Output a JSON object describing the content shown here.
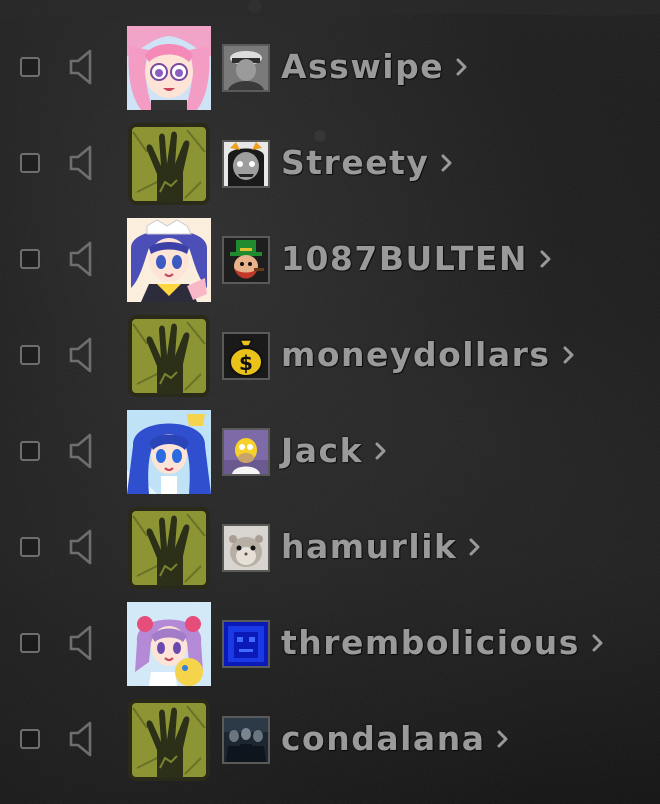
{
  "players": [
    {
      "name": "Asswipe",
      "large_avatar": "anime-pink-hair-girl",
      "small_avatar": "soldier-photo-avatar"
    },
    {
      "name": "Streety",
      "large_avatar": "zombie-hand-icon",
      "small_avatar": "grey-troll-avatar"
    },
    {
      "name": "1087BULTEN",
      "large_avatar": "anime-maid-blue-hair-girl",
      "small_avatar": "leprechaun-avatar"
    },
    {
      "name": "moneydollars",
      "large_avatar": "zombie-hand-icon",
      "small_avatar": "money-bag-avatar"
    },
    {
      "name": "Jack",
      "large_avatar": "anime-blue-hair-girl",
      "small_avatar": "homer-simpson-avatar"
    },
    {
      "name": "hamurlik",
      "large_avatar": "zombie-hand-icon",
      "small_avatar": "hamster-avatar"
    },
    {
      "name": "thrembolicious",
      "large_avatar": "anime-purple-hair-girl",
      "small_avatar": "blue-pixel-face-avatar"
    },
    {
      "name": "condalana",
      "large_avatar": "zombie-hand-icon",
      "small_avatar": "band-photo-avatar"
    }
  ],
  "colors": {
    "name_text": "#9a9a9a",
    "icon_gray": "#6e6e6e",
    "zombie_tile": "#8c9433",
    "background": "#151515"
  }
}
